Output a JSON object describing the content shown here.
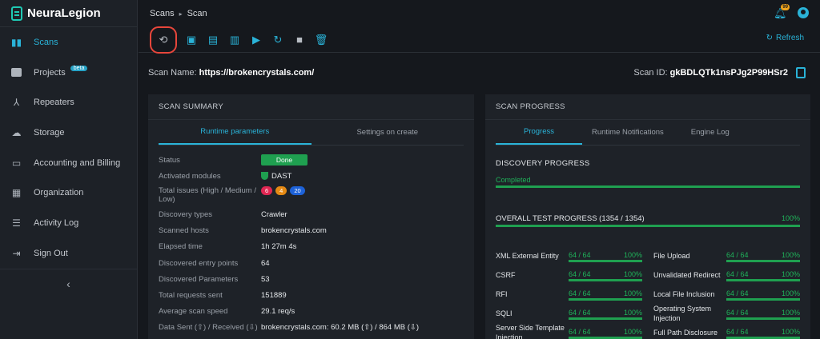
{
  "app": {
    "name": "NeuraLegion"
  },
  "sidebar": {
    "items": [
      {
        "label": "Scans",
        "icon": "chart-icon",
        "active": true
      },
      {
        "label": "Projects",
        "icon": "folder-icon",
        "badge": "beta"
      },
      {
        "label": "Repeaters",
        "icon": "network-icon"
      },
      {
        "label": "Storage",
        "icon": "cloud-icon"
      },
      {
        "label": "Accounting and Billing",
        "icon": "credit-card-icon"
      },
      {
        "label": "Organization",
        "icon": "building-icon"
      },
      {
        "label": "Activity Log",
        "icon": "list-icon"
      },
      {
        "label": "Sign Out",
        "icon": "sign-out-icon"
      }
    ],
    "collapse_glyph": "‹"
  },
  "header": {
    "breadcrumb": [
      "Scans",
      "Scan"
    ],
    "separator": "▸",
    "notification_count": "99"
  },
  "toolbar": {
    "refresh_label": "Refresh"
  },
  "scan": {
    "name_label": "Scan Name:",
    "name_value": "https://brokencrystals.com/",
    "id_label": "Scan ID:",
    "id_value": "gkBDLQTk1nsPJg2P99HSr2"
  },
  "summary": {
    "title": "SCAN SUMMARY",
    "tabs": [
      "Runtime parameters",
      "Settings on create"
    ],
    "status_label": "Status",
    "status_value": "Done",
    "modules_label": "Activated modules",
    "modules_value": "DAST",
    "issues_label": "Total issues (High / Medium / Low)",
    "issues": {
      "high": "6",
      "medium": "4",
      "low": "20"
    },
    "rows": [
      {
        "label": "Discovery types",
        "value": "Crawler"
      },
      {
        "label": "Scanned hosts",
        "value": "brokencrystals.com"
      },
      {
        "label": "Elapsed time",
        "value": "1h 27m 4s"
      },
      {
        "label": "Discovered entry points",
        "value": "64"
      },
      {
        "label": "Discovered Parameters",
        "value": "53"
      },
      {
        "label": "Total requests sent",
        "value": "151889"
      },
      {
        "label": "Average scan speed",
        "value": "29.1 req/s"
      },
      {
        "label": "Data Sent (⇧) / Received (⇩)",
        "value": "brokencrystals.com: 60.2 MB (⇧) / 864 MB (⇩)"
      }
    ],
    "colors": {
      "high": "#e02753",
      "medium": "#e58a14",
      "low": "#1d62d8",
      "done": "#1fa050"
    }
  },
  "progress": {
    "title": "SCAN PROGRESS",
    "tabs": [
      "Progress",
      "Runtime Notifications",
      "Engine Log"
    ],
    "discovery_title": "DISCOVERY PROGRESS",
    "discovery_status": "Completed",
    "overall_title": "OVERALL TEST PROGRESS (1354 / 1354)",
    "overall_percent": "100%",
    "tests": [
      {
        "name": "XML External Entity",
        "count": "64 / 64",
        "percent": "100%"
      },
      {
        "name": "File Upload",
        "count": "64 / 64",
        "percent": "100%"
      },
      {
        "name": "CSRF",
        "count": "64 / 64",
        "percent": "100%"
      },
      {
        "name": "Unvalidated Redirect",
        "count": "64 / 64",
        "percent": "100%"
      },
      {
        "name": "RFI",
        "count": "64 / 64",
        "percent": "100%"
      },
      {
        "name": "Local File Inclusion",
        "count": "64 / 64",
        "percent": "100%"
      },
      {
        "name": "SQLI",
        "count": "64 / 64",
        "percent": "100%"
      },
      {
        "name": "Operating System Injection",
        "count": "64 / 64",
        "percent": "100%"
      },
      {
        "name": "Server Side Template Injection",
        "count": "64 / 64",
        "percent": "100%"
      },
      {
        "name": "Full Path Disclosure",
        "count": "64 / 64",
        "percent": "100%"
      }
    ],
    "accent": "#1fa050"
  }
}
